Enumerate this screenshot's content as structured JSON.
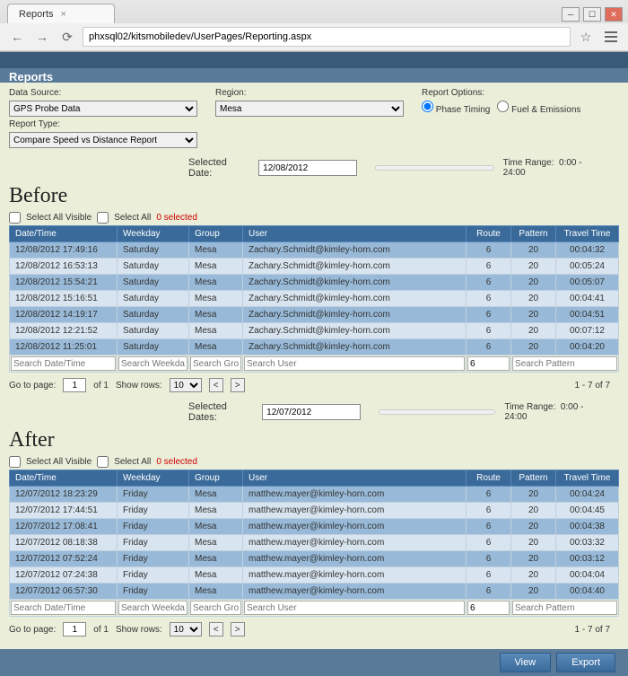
{
  "browser": {
    "tab_title": "Reports",
    "url": "phxsql02/kitsmobiledev/UserPages/Reporting.aspx"
  },
  "page_title": "Reports",
  "filters": {
    "data_source_label": "Data Source:",
    "data_source_value": "GPS Probe Data",
    "region_label": "Region:",
    "region_value": "Mesa",
    "report_options_label": "Report Options:",
    "opt_phase": "Phase Timing",
    "opt_fuel": "Fuel & Emissions",
    "report_type_label": "Report Type:",
    "report_type_value": "Compare Speed vs Distance Report"
  },
  "before": {
    "title": "Before",
    "selected_date_label": "Selected Date:",
    "selected_date": "12/08/2012",
    "time_range_label": "Time Range:",
    "time_range_value": "0:00 - 24:00",
    "select_all_visible": "Select All Visible",
    "select_all": "Select All",
    "selected_count": "0 selected",
    "headers": {
      "dt": "Date/Time",
      "wd": "Weekday",
      "grp": "Group",
      "usr": "User",
      "rt": "Route",
      "pat": "Pattern",
      "tt": "Travel Time"
    },
    "rows": [
      {
        "dt": "12/08/2012 17:49:16",
        "wd": "Saturday",
        "grp": "Mesa",
        "usr": "Zachary.Schmidt@kimley-horn.com",
        "rt": "6",
        "pat": "20",
        "tt": "00:04:32"
      },
      {
        "dt": "12/08/2012 16:53:13",
        "wd": "Saturday",
        "grp": "Mesa",
        "usr": "Zachary.Schmidt@kimley-horn.com",
        "rt": "6",
        "pat": "20",
        "tt": "00:05:24"
      },
      {
        "dt": "12/08/2012 15:54:21",
        "wd": "Saturday",
        "grp": "Mesa",
        "usr": "Zachary.Schmidt@kimley-horn.com",
        "rt": "6",
        "pat": "20",
        "tt": "00:05:07"
      },
      {
        "dt": "12/08/2012 15:16:51",
        "wd": "Saturday",
        "grp": "Mesa",
        "usr": "Zachary.Schmidt@kimley-horn.com",
        "rt": "6",
        "pat": "20",
        "tt": "00:04:41"
      },
      {
        "dt": "12/08/2012 14:19:17",
        "wd": "Saturday",
        "grp": "Mesa",
        "usr": "Zachary.Schmidt@kimley-horn.com",
        "rt": "6",
        "pat": "20",
        "tt": "00:04:51"
      },
      {
        "dt": "12/08/2012 12:21:52",
        "wd": "Saturday",
        "grp": "Mesa",
        "usr": "Zachary.Schmidt@kimley-horn.com",
        "rt": "6",
        "pat": "20",
        "tt": "00:07:12"
      },
      {
        "dt": "12/08/2012 11:25:01",
        "wd": "Saturday",
        "grp": "Mesa",
        "usr": "Zachary.Schmidt@kimley-horn.com",
        "rt": "6",
        "pat": "20",
        "tt": "00:04:20"
      }
    ],
    "search": {
      "dt": "Search Date/Time",
      "wd": "Search Weekday",
      "grp": "Search Group",
      "usr": "Search User",
      "rt": "6",
      "pat": "Search Pattern"
    },
    "pager": {
      "goto": "Go to page:",
      "page": "1",
      "of": "of 1",
      "showrows": "Show rows:",
      "rows": "10",
      "count": "1 - 7 of 7"
    }
  },
  "after": {
    "title": "After",
    "selected_date_label": "Selected Dates:",
    "selected_date": "12/07/2012",
    "time_range_label": "Time Range:",
    "time_range_value": "0:00 - 24:00",
    "select_all_visible": "Select All Visible",
    "select_all": "Select All",
    "selected_count": "0 selected",
    "headers": {
      "dt": "Date/Time",
      "wd": "Weekday",
      "grp": "Group",
      "usr": "User",
      "rt": "Route",
      "pat": "Pattern",
      "tt": "Travel Time"
    },
    "rows": [
      {
        "dt": "12/07/2012 18:23:29",
        "wd": "Friday",
        "grp": "Mesa",
        "usr": "matthew.mayer@kimley-horn.com",
        "rt": "6",
        "pat": "20",
        "tt": "00:04:24"
      },
      {
        "dt": "12/07/2012 17:44:51",
        "wd": "Friday",
        "grp": "Mesa",
        "usr": "matthew.mayer@kimley-horn.com",
        "rt": "6",
        "pat": "20",
        "tt": "00:04:45"
      },
      {
        "dt": "12/07/2012 17:08:41",
        "wd": "Friday",
        "grp": "Mesa",
        "usr": "matthew.mayer@kimley-horn.com",
        "rt": "6",
        "pat": "20",
        "tt": "00:04:38"
      },
      {
        "dt": "12/07/2012 08:18:38",
        "wd": "Friday",
        "grp": "Mesa",
        "usr": "matthew.mayer@kimley-horn.com",
        "rt": "6",
        "pat": "20",
        "tt": "00:03:32"
      },
      {
        "dt": "12/07/2012 07:52:24",
        "wd": "Friday",
        "grp": "Mesa",
        "usr": "matthew.mayer@kimley-horn.com",
        "rt": "6",
        "pat": "20",
        "tt": "00:03:12"
      },
      {
        "dt": "12/07/2012 07:24:38",
        "wd": "Friday",
        "grp": "Mesa",
        "usr": "matthew.mayer@kimley-horn.com",
        "rt": "6",
        "pat": "20",
        "tt": "00:04:04"
      },
      {
        "dt": "12/07/2012 06:57:30",
        "wd": "Friday",
        "grp": "Mesa",
        "usr": "matthew.mayer@kimley-horn.com",
        "rt": "6",
        "pat": "20",
        "tt": "00:04:40"
      }
    ],
    "search": {
      "dt": "Search Date/Time",
      "wd": "Search Weekday",
      "grp": "Search Group",
      "usr": "Search User",
      "rt": "6",
      "pat": "Search Pattern"
    },
    "pager": {
      "goto": "Go to page:",
      "page": "1",
      "of": "of 1",
      "showrows": "Show rows:",
      "rows": "10",
      "count": "1 - 7 of 7"
    }
  },
  "footer": {
    "view": "View",
    "export": "Export"
  }
}
